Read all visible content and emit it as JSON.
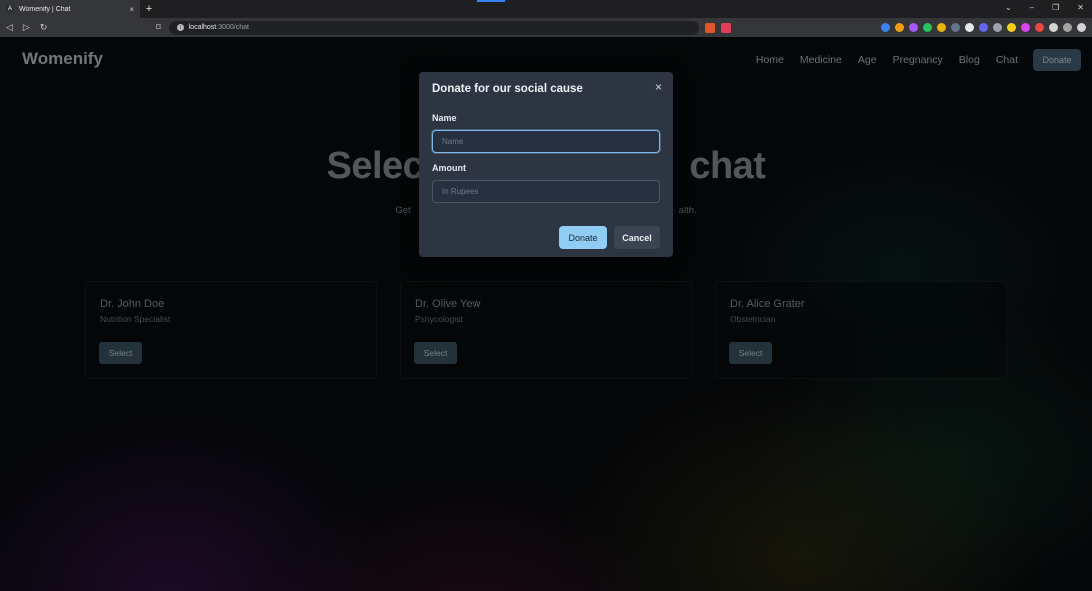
{
  "browser": {
    "tab_title": "Womenify | Chat",
    "tab_favicon": "A",
    "new_tab": "+",
    "tab_close": "×",
    "url_host": "localhost",
    "url_path": ":3000/chat"
  },
  "header": {
    "brand": "Womenify",
    "nav": [
      "Home",
      "Medicine",
      "Age",
      "Pregnancy",
      "Blog",
      "Chat"
    ],
    "donate_label": "Donate"
  },
  "hero": {
    "title_left": "Selec",
    "title_right": "chat",
    "subtitle_left": "Get",
    "subtitle_right": "alth."
  },
  "doctors": [
    {
      "name": "Dr. John Doe",
      "role": "Nutrition Specialist",
      "select_label": "Select"
    },
    {
      "name": "Dr. Olive Yew",
      "role": "Pshycologist",
      "select_label": "Select"
    },
    {
      "name": "Dr. Alice Grater",
      "role": "Obstetrician",
      "select_label": "Select"
    }
  ],
  "modal": {
    "title": "Donate for our social cause",
    "close": "×",
    "name_label": "Name",
    "name_placeholder": "Name",
    "amount_label": "Amount",
    "amount_placeholder": "In Rupees",
    "donate_label": "Donate",
    "cancel_label": "Cancel"
  },
  "colors": {
    "accent": "#90cdf4",
    "nav_button": "#4b6a80",
    "select_button": "#40596c",
    "modal_bg": "#2d3543"
  }
}
